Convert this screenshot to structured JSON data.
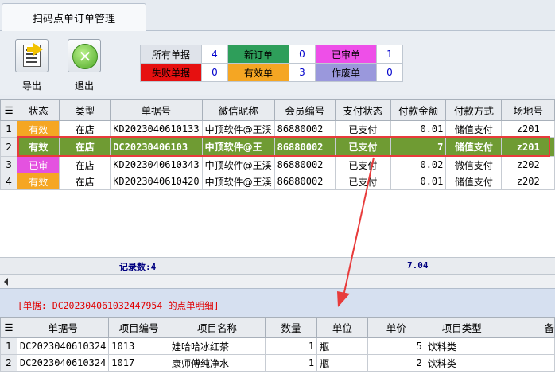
{
  "window": {
    "tab_title": "扫码点单订单管理"
  },
  "toolbar": {
    "export_label": "导出",
    "exit_label": "退出"
  },
  "stats": [
    {
      "label": "所有单据",
      "value": "4",
      "bg": "#dfe3ea"
    },
    {
      "label": "新订单",
      "value": "0",
      "bg": "#2e9e5a"
    },
    {
      "label": "已审单",
      "value": "1",
      "bg": "#ee4fe8"
    },
    {
      "label": "失败单据",
      "value": "0",
      "bg": "#e61010"
    },
    {
      "label": "有效单",
      "value": "3",
      "bg": "#f5a623"
    },
    {
      "label": "作废单",
      "value": "0",
      "bg": "#9a98dc"
    }
  ],
  "orders": {
    "headers": [
      "状态",
      "类型",
      "单据号",
      "微信昵称",
      "会员编号",
      "支付状态",
      "付款金额",
      "付款方式",
      "场地号"
    ],
    "rows": [
      {
        "n": "1",
        "status": "有效",
        "type": "在店",
        "no": "KD2023040610133",
        "nick": "中顶软件@王渓",
        "member": "86880002",
        "pay_status": "已支付",
        "amount": "0.01",
        "method": "储值支付",
        "venue": "z201"
      },
      {
        "n": "2",
        "status": "有效",
        "type": "在店",
        "no": "DC20230406103",
        "nick": "中顶软件@王",
        "member": "86880002",
        "pay_status": "已支付",
        "amount": "7",
        "method": "储值支付",
        "venue": "z201"
      },
      {
        "n": "3",
        "status": "已审",
        "type": "在店",
        "no": "KD2023040610343",
        "nick": "中顶软件@王渓",
        "member": "86880002",
        "pay_status": "已支付",
        "amount": "0.02",
        "method": "微信支付",
        "venue": "z202"
      },
      {
        "n": "4",
        "status": "有效",
        "type": "在店",
        "no": "KD2023040610420",
        "nick": "中顶软件@王渓",
        "member": "86880002",
        "pay_status": "已支付",
        "amount": "0.01",
        "method": "储值支付",
        "venue": "z202"
      }
    ],
    "summary": {
      "record_count": "记录数:4",
      "total": "7.04"
    }
  },
  "detail": {
    "title": "[单据: DC202304061032447954 的点单明细]",
    "headers": [
      "单据号",
      "项目编号",
      "项目名称",
      "数量",
      "单位",
      "单价",
      "项目类型",
      "备"
    ],
    "rows": [
      {
        "n": "1",
        "no": "DC2023040610324",
        "code": "1013",
        "name": "娃哈哈冰红茶",
        "qty": "1",
        "unit": "瓶",
        "price": "5",
        "cat": "饮料类"
      },
      {
        "n": "2",
        "no": "DC2023040610324",
        "code": "1017",
        "name": "康师傅纯净水",
        "qty": "1",
        "unit": "瓶",
        "price": "2",
        "cat": "饮料类"
      }
    ]
  },
  "colors": {
    "selected_row": "#6f9b33",
    "annotation": "#e83b3b"
  }
}
